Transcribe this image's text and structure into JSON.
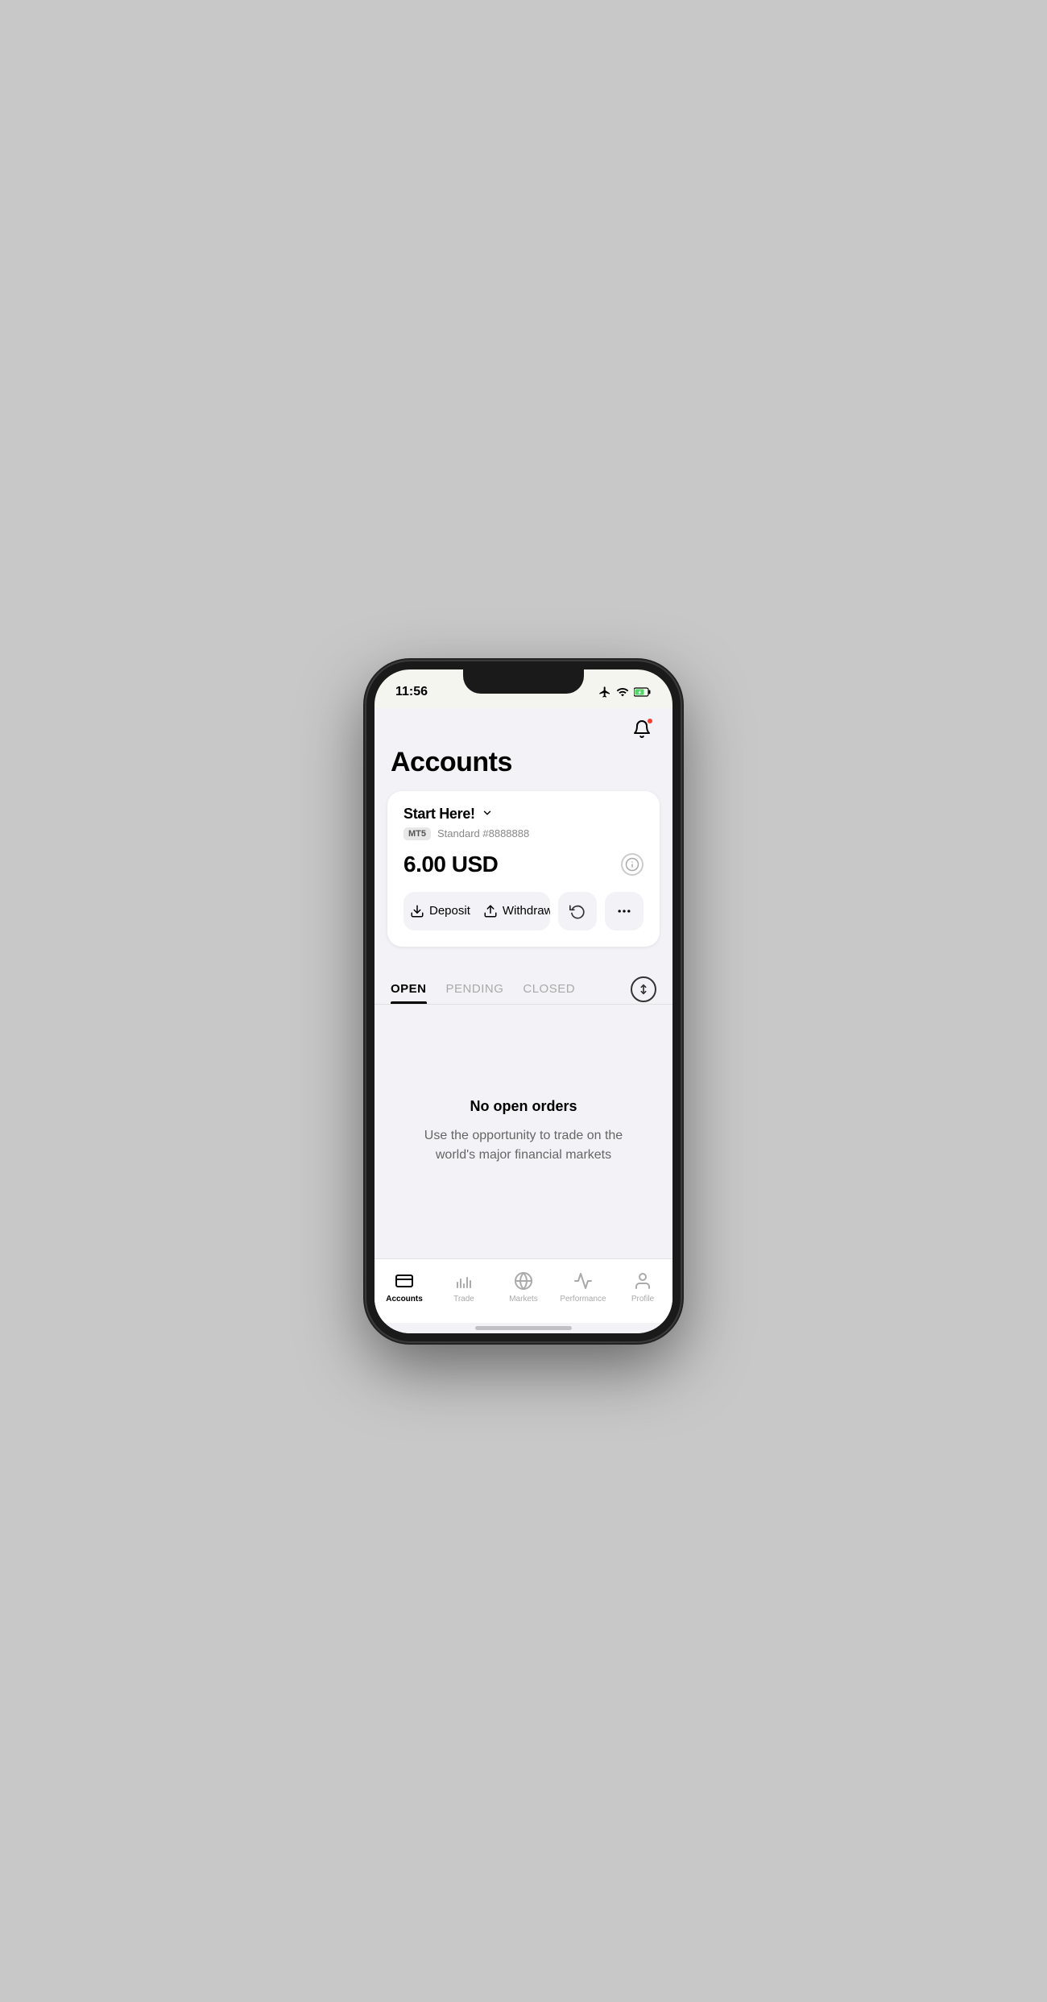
{
  "status_bar": {
    "time": "11:56"
  },
  "header": {
    "title": "Accounts"
  },
  "account_card": {
    "name": "Start Here!",
    "badge": "MT5",
    "number": "Standard #8888888",
    "balance": "6.00 USD",
    "deposit_label": "Deposit",
    "withdraw_label": "Withdraw"
  },
  "tabs": {
    "open_label": "OPEN",
    "pending_label": "PENDING",
    "closed_label": "CLOSED",
    "active": "OPEN"
  },
  "empty_state": {
    "title": "No open orders",
    "subtitle": "Use the opportunity to trade on the world's major financial markets"
  },
  "bottom_nav": {
    "items": [
      {
        "id": "accounts",
        "label": "Accounts",
        "active": true
      },
      {
        "id": "trade",
        "label": "Trade",
        "active": false
      },
      {
        "id": "markets",
        "label": "Markets",
        "active": false
      },
      {
        "id": "performance",
        "label": "Performance",
        "active": false
      },
      {
        "id": "profile",
        "label": "Profile",
        "active": false
      }
    ]
  }
}
